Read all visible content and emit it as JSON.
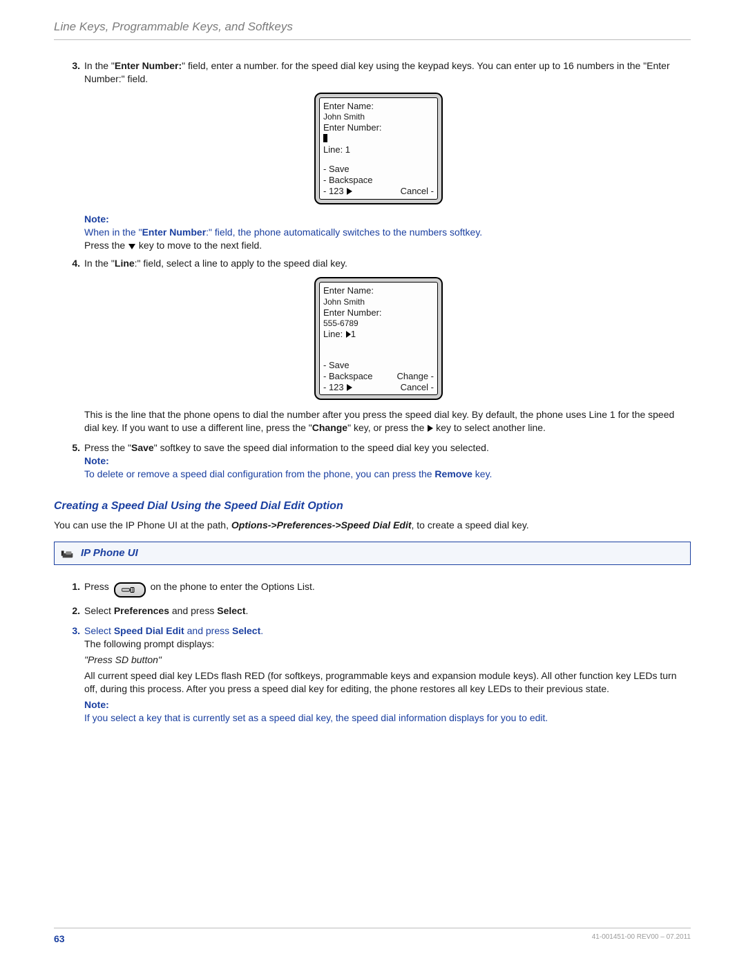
{
  "header": {
    "chapter_title": "Line Keys, Programmable Keys, and Softkeys"
  },
  "step3": {
    "num": "3.",
    "text_before": "In the \"",
    "field_bold": "Enter Number:",
    "text_after": "\" field, enter a number. for the speed dial key using the keypad keys. You can enter up to 16 numbers in the \"Enter Number:\" field.",
    "note_label": "Note:",
    "note_line1a": "When in the \"",
    "note_line1_bold": "Enter Number",
    "note_line1b": ":\" field, the phone automatically switches to the numbers softkey.",
    "press_the": "Press the ",
    "press_post": " key to move to the next field."
  },
  "phone1": {
    "l1": "Enter Name:",
    "l2": "John Smith",
    "l3": "Enter Number:",
    "line_label": "Line: 1",
    "save": "- Save",
    "backspace": "- Backspace",
    "mode": "- 123",
    "cancel": "Cancel -"
  },
  "step4": {
    "num": "4.",
    "text_before": "In the \"",
    "field_bold": "Line",
    "text_after": ":\" field, select a line to apply to the speed dial key."
  },
  "phone2": {
    "l1": "Enter Name:",
    "l2": "John Smith",
    "l3": "Enter Number:",
    "l4": "555-6789",
    "line_label_pre": "Line: ",
    "line_val": "1",
    "save": "- Save",
    "backspace": "- Backspace",
    "change": "Change -",
    "mode": "- 123",
    "cancel": "Cancel -"
  },
  "line_explain": {
    "p1a": "This is the line that the phone opens to dial the number after you press the speed dial key. By default, the phone uses Line 1 for the speed dial key. If you want to use a different line, press the \"",
    "p1_bold": "Change",
    "p1b": "\" key, or press the ",
    "p1c": " key to select another line."
  },
  "step5": {
    "num": "5.",
    "text_before": "Press the \"",
    "save_bold": "Save",
    "text_after": "\" softkey to save the speed dial information to the speed dial key you selected.",
    "note_label": "Note:",
    "note_line_a": "To delete or remove a speed dial configuration from the phone, you can press the ",
    "note_remove_bold": "Remove",
    "note_line_b": " key."
  },
  "subhead": {
    "title": "Creating a Speed Dial Using the Speed Dial Edit Option",
    "intro_a": "You can use the IP Phone UI at the path, ",
    "intro_bold": "Options->Preferences->Speed Dial Edit",
    "intro_b": ", to create a speed dial key."
  },
  "ui_box": {
    "label": "IP Phone UI"
  },
  "step_b1": {
    "num": "1.",
    "press": "Press ",
    "tail": " on the phone to enter the Options List."
  },
  "step_b2": {
    "num": "2.",
    "a": "Select ",
    "b": "Preferences",
    "c": " and press ",
    "d": "Select",
    "e": "."
  },
  "step_b3": {
    "num": "3.",
    "a": "Select ",
    "b": "Speed Dial Edit",
    "c": " and press ",
    "d": "Select",
    "e": ".",
    "following": "The following prompt displays:",
    "prompt": "\"Press SD button\"",
    "para": "All current speed dial key LEDs flash RED (for softkeys, programmable keys and expansion module keys). All other function key LEDs turn off, during this process. After you press a speed dial key for editing, the phone restores all key LEDs to their previous state.",
    "note_label": "Note:",
    "note_text": "If you select a key that is currently set as a speed dial key, the speed dial information displays for you to edit."
  },
  "footer": {
    "page": "63",
    "rev": "41-001451-00 REV00 – 07.2011"
  }
}
